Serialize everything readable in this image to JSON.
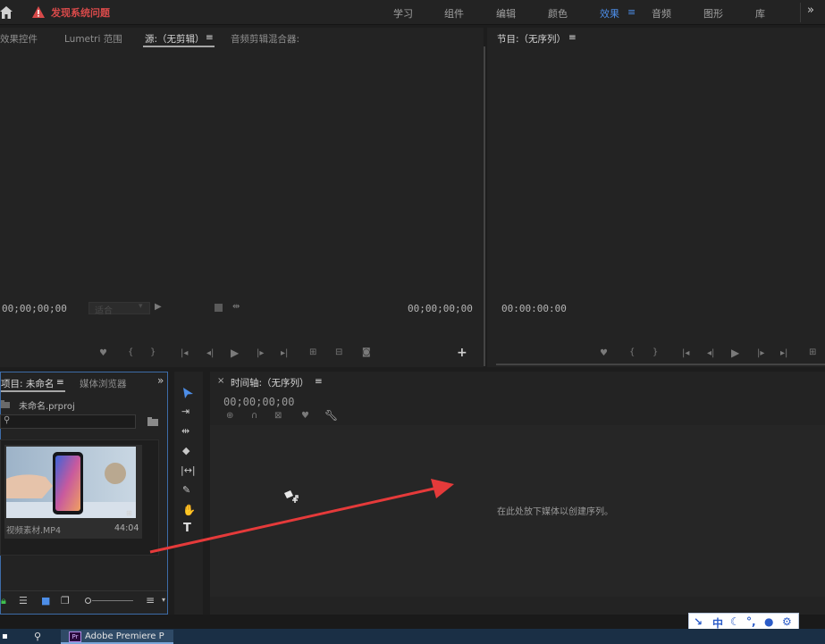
{
  "topbar": {
    "alert_text": "发现系统问题",
    "workspaces": [
      "学习",
      "组件",
      "编辑",
      "颜色",
      "效果",
      "音频",
      "图形",
      "库"
    ],
    "active_workspace": "效果",
    "menu_glyph": "≡",
    "more_glyph": "»"
  },
  "source_panel": {
    "tabs": [
      "效果控件",
      "Lumetri 范围",
      "源:（无剪辑）",
      "音频剪辑混合器:"
    ],
    "active_tab": "源:（无剪辑）",
    "timecode_in": "00;00;00;00",
    "timecode_out": "00;00;00;00",
    "zoom_select": "适合"
  },
  "program_panel": {
    "title": "节目:（无序列）",
    "timecode": "00:00:00:00"
  },
  "project_panel": {
    "tab_project": "项目: 未命名",
    "tab_browser": "媒体浏览器",
    "file_name": "未命名.prproj",
    "clip_name": "视频素材.MP4",
    "clip_duration": "44:04"
  },
  "timeline_panel": {
    "title": "时间轴:（无序列）",
    "timecode": "00;00;00;00",
    "drop_hint": "在此处放下媒体以创建序列。"
  },
  "taskbar": {
    "app_label": "Adobe Premiere P"
  },
  "ime": {
    "lang": "中"
  },
  "colors": {
    "accent": "#4d8ee8",
    "alert": "#d84a4a",
    "arrow": "#e53a3a",
    "panel_bg": "#232323"
  }
}
